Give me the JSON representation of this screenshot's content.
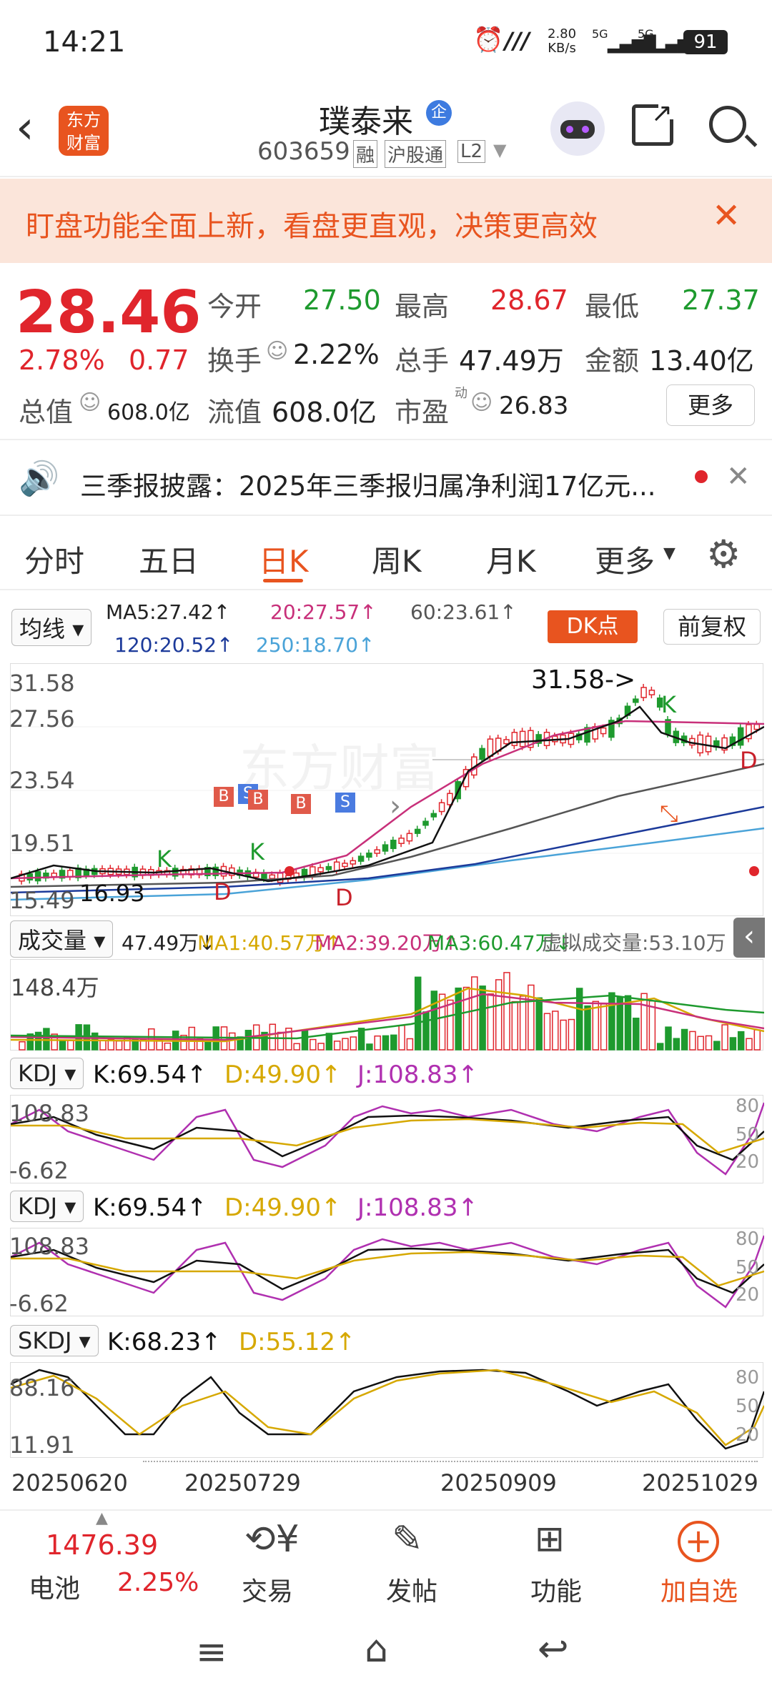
{
  "status": {
    "time": "14:21",
    "speed": "2.80",
    "speed_unit": "KB/s",
    "net1": "5G",
    "net2": "5G",
    "battery": "91"
  },
  "header": {
    "logo": "东方财富",
    "name": "璞泰来",
    "badge": "企",
    "code": "603659",
    "tags": [
      "融",
      "沪股通",
      "L2"
    ]
  },
  "banner": {
    "text": "盯盘功能全面上新，看盘更直观，决策更高效"
  },
  "quote": {
    "price": "28.46",
    "pct": "2.78%",
    "chg": "0.77",
    "open_l": "今开",
    "open": "27.50",
    "high_l": "最高",
    "high": "28.67",
    "low_l": "最低",
    "low": "27.37",
    "turn_l": "换手",
    "turn": "2.22%",
    "vol_l": "总手",
    "vol": "47.49万",
    "amt_l": "金额",
    "amt": "13.40亿",
    "cap_l": "总值",
    "cap": "608.0亿",
    "float_l": "流值",
    "float": "608.0亿",
    "pe_l": "市盈",
    "pe_sup": "动",
    "pe": "26.83",
    "more": "更多"
  },
  "news": {
    "text": "三季报披露：2025年三季报归属净利润17亿元..."
  },
  "tabs": [
    "分时",
    "五日",
    "日K",
    "周K",
    "月K",
    "更多"
  ],
  "ma": {
    "sel": "均线",
    "ma5": "MA5:27.42",
    "ma20": "20:27.57",
    "ma60": "60:23.61",
    "ma120": "120:20.52",
    "ma250": "250:18.70",
    "dk": "DK点",
    "fq": "前复权"
  },
  "kline": {
    "y": [
      "31.58",
      "27.56",
      "23.54",
      "19.51",
      "15.49"
    ],
    "hi": "31.58->",
    "lo": "16.93",
    "k": "K",
    "d": "D"
  },
  "volume": {
    "sel": "成交量",
    "v": "47.49万",
    "ma1": "MA1:40.57万",
    "ma2": "MA2:39.20万",
    "ma3": "MA3:60.47万",
    "virt": "虚拟成交量:53.10万",
    "max": "148.4万"
  },
  "kdj1": {
    "sel": "KDJ",
    "k": "K:69.54",
    "d": "D:49.90",
    "j": "J:108.83",
    "top": "108.83",
    "bot": "-6.62",
    "r": [
      "80",
      "50",
      "20"
    ]
  },
  "kdj2": {
    "sel": "KDJ",
    "k": "K:69.54",
    "d": "D:49.90",
    "j": "J:108.83",
    "top": "108.83",
    "bot": "-6.62",
    "r": [
      "80",
      "50",
      "20"
    ]
  },
  "skdj": {
    "sel": "SKDJ",
    "k": "K:68.23",
    "d": "D:55.12",
    "top": "88.16",
    "bot": "11.91",
    "r": [
      "80",
      "50",
      "20"
    ]
  },
  "dates": [
    "20250620",
    "20250729",
    "20250909",
    "20251029"
  ],
  "bottom": {
    "index": "1476.39",
    "index_name": "电池",
    "index_pct": "2.25%",
    "items": [
      "交易",
      "发帖",
      "功能",
      "加自选"
    ]
  }
}
